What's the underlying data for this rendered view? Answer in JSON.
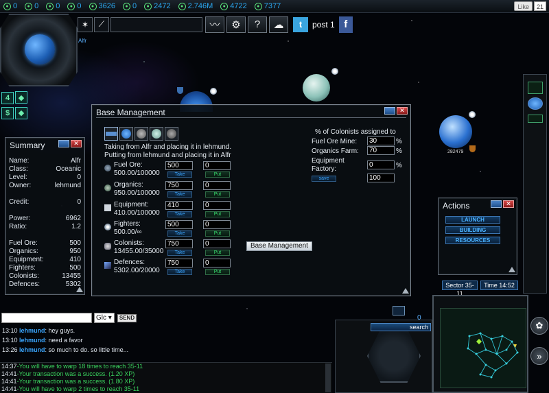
{
  "topbar": {
    "resources": [
      {
        "name": "res-a",
        "value": "0"
      },
      {
        "name": "res-b",
        "value": "0"
      },
      {
        "name": "res-c",
        "value": "0"
      },
      {
        "name": "res-d",
        "value": "0"
      },
      {
        "name": "res-e",
        "value": "3626"
      },
      {
        "name": "res-f",
        "value": "0"
      },
      {
        "name": "res-g",
        "value": "2472"
      },
      {
        "name": "res-h",
        "value": "2.746M"
      },
      {
        "name": "res-i",
        "value": "4722"
      },
      {
        "name": "res-j",
        "value": "7377"
      }
    ],
    "like_label": "Like",
    "like_count": "21"
  },
  "planet_name": "Alfr",
  "toolbar": {
    "help_label": "?",
    "post_label": "post 1",
    "facebook_label": "f",
    "twitter_label": "t"
  },
  "side": {
    "level_badge": "4",
    "money_badge": "$"
  },
  "space": {
    "planet_label": "282479"
  },
  "summary": {
    "title": "Summary",
    "rows": [
      {
        "label": "Name:",
        "value": "Alfr"
      },
      {
        "label": "Class:",
        "value": "Oceanic"
      },
      {
        "label": "Level:",
        "value": "0"
      },
      {
        "label": "Owner:",
        "value": "lehmund"
      },
      {
        "label": "Credit:",
        "value": "0"
      },
      {
        "label": "Power:",
        "value": "6962"
      },
      {
        "label": "Ratio:",
        "value": "1.2"
      },
      {
        "label": "Fuel Ore:",
        "value": "500"
      },
      {
        "label": "Organics:",
        "value": "950"
      },
      {
        "label": "Equipment:",
        "value": "410"
      },
      {
        "label": "Fighters:",
        "value": "500"
      },
      {
        "label": "Colonists:",
        "value": "13455"
      },
      {
        "label": "Defences:",
        "value": "5302"
      }
    ]
  },
  "base": {
    "title": "Base Management",
    "taking_text": "Taking from Alfr and placing it in lehmund.",
    "putting_text": "Putting from lehmund and placing it in Alfr",
    "take_label": "Take",
    "put_label": "Put",
    "resources": [
      {
        "label": "Fuel Ore:",
        "amount": "500.00/100000",
        "take": "500",
        "put": "0"
      },
      {
        "label": "Organics:",
        "amount": "950.00/100000",
        "take": "750",
        "put": "0"
      },
      {
        "label": "Equipment:",
        "amount": "410.00/100000",
        "take": "410",
        "put": "0"
      },
      {
        "label": "Fighters:",
        "amount": "500.00/∞",
        "take": "500",
        "put": "0"
      },
      {
        "label": "Colonists:",
        "amount": "13455.00/35000",
        "take": "750",
        "put": "0"
      },
      {
        "label": "Defences:",
        "amount": "5302.00/20000",
        "take": "750",
        "put": "0"
      }
    ],
    "colonist_heading": "% of Colonists assigned to",
    "fuel_mine_label": "Fuel Ore Mine:",
    "fuel_mine_value": "30",
    "organics_farm_label": "Organics Farm:",
    "organics_farm_value": "70",
    "equipment_factory_label1": "Equipment",
    "equipment_factory_label2": "Factory:",
    "equipment_factory_value": "0",
    "pct_sign": "%",
    "save_label": "save",
    "total_value": "100",
    "center_button_label": "Base Management"
  },
  "actions": {
    "title": "Actions",
    "launch": "LAUNCH",
    "building": "BUILDING",
    "resources": "RESOURCES"
  },
  "status": {
    "sector": "Sector 35-11",
    "time": "Time 14:52"
  },
  "chat": {
    "channel": "Glc",
    "send_label": "SEND",
    "messages": [
      {
        "time": "13:10",
        "user": "lehmund",
        "text": ": hey guys."
      },
      {
        "time": "13:10",
        "user": "lehmund",
        "text": ": need a favor"
      },
      {
        "time": "13:26",
        "user": "lehmund",
        "text": ": so much to do. so little time..."
      }
    ]
  },
  "log": {
    "lines": [
      {
        "time": "14:37",
        "text": "-You will have to warp 18 times to reach 35-11"
      },
      {
        "time": "14:41",
        "text": "-Your transaction was a success. (1.20 XP)"
      },
      {
        "time": "14:41",
        "text": "-Your transaction was a success. (1.80 XP)"
      },
      {
        "time": "14:41",
        "text": "-You will have to warp 2 times to reach 35-11"
      }
    ]
  },
  "bottom": {
    "search_label": "search",
    "zero_value": "0"
  },
  "colors": {
    "accent_blue": "#2ba7f0",
    "log_green": "#3ad35e",
    "close_red": "#c83232"
  }
}
